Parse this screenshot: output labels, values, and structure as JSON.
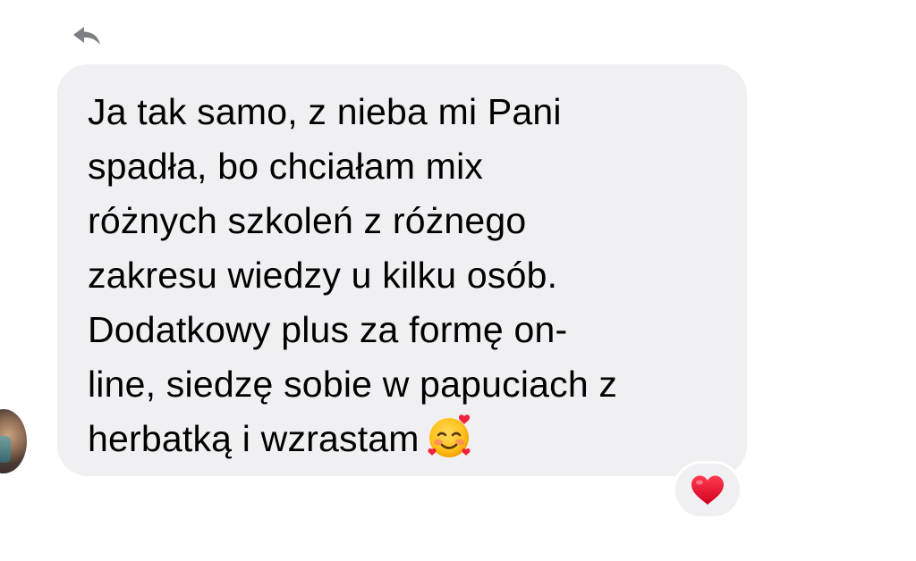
{
  "message": {
    "lines": [
      "Ja tak samo, z nieba mi Pani",
      "spadła, bo chciałam mix",
      "różnych szkoleń z różnego",
      "zakresu wiedzy u kilku osób.",
      "Dodatkowy plus za formę on-",
      "line, siedzę sobie w papuciach z",
      "herbatką i wzrastam"
    ],
    "trailing_emoji": "smiling-face-with-hearts"
  },
  "reply": {
    "icon": "reply-arrow-icon"
  },
  "reaction": {
    "icon": "red-heart",
    "color": "#e3112b"
  },
  "colors": {
    "bubble_background": "#f0f0f2",
    "text": "#000000",
    "icon_gray": "#7d7f85"
  }
}
